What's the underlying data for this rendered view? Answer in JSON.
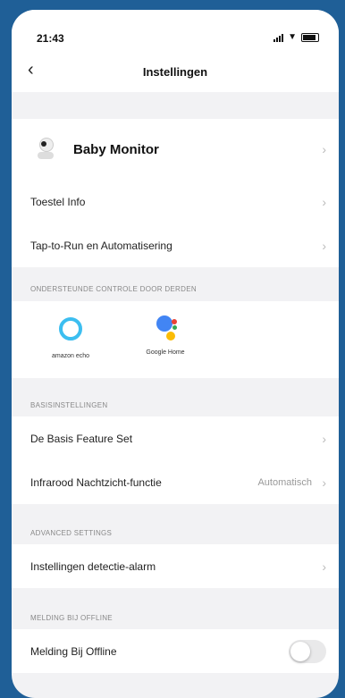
{
  "status": {
    "time": "21:43"
  },
  "nav": {
    "title": "Instellingen"
  },
  "device": {
    "name": "Baby Monitor"
  },
  "rows_top": [
    {
      "label": "Toestel Info"
    },
    {
      "label": "Tap-to-Run en Automatisering"
    }
  ],
  "third_party": {
    "header": "ONDERSTEUNDE CONTROLE DOOR DERDEN",
    "partners": [
      {
        "label": "amazon echo"
      },
      {
        "label": "Google Home"
      }
    ]
  },
  "basic": {
    "header": "BASISINSTELLINGEN",
    "rows": [
      {
        "label": "De Basis Feature Set"
      },
      {
        "label": "Infrarood Nachtzicht-functie",
        "value": "Automatisch"
      }
    ]
  },
  "advanced": {
    "header": "ADVANCED SETTINGS",
    "rows": [
      {
        "label": "Instellingen detectie-alarm"
      }
    ]
  },
  "offline": {
    "header": "MELDING BIJ OFFLINE",
    "row": {
      "label": "Melding Bij Offline",
      "enabled": false
    }
  },
  "colors": {
    "background": "#1f5f97",
    "alexa": "#3cbef0"
  },
  "icons": {
    "back": "chevron-left-icon",
    "row": "chevron-right-icon"
  }
}
